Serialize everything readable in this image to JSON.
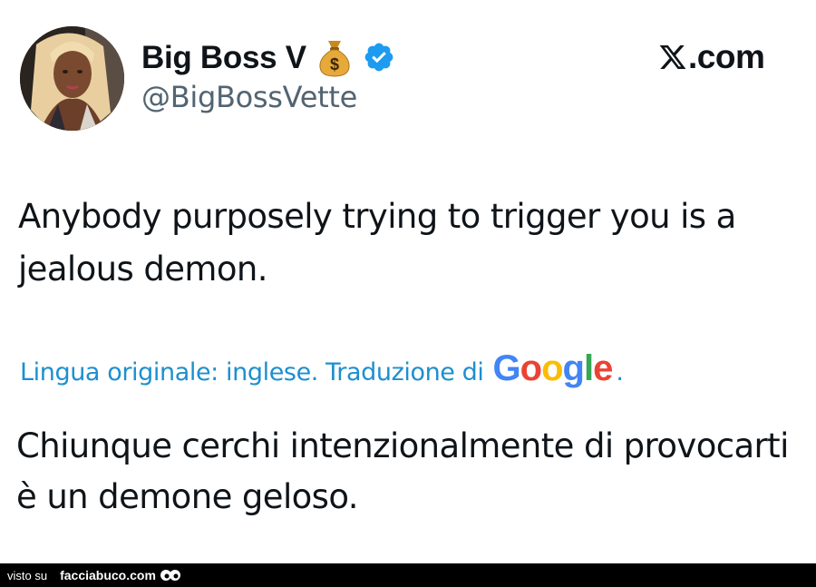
{
  "tweet": {
    "display_name": "Big Boss V",
    "name_emoji": "money-bag-icon",
    "verified_badge": "verified-badge-icon",
    "handle": "@BigBossVette",
    "source_logo": "X",
    "source_domain": ".com",
    "text": "Anybody purposely trying to trigger you is a jealous demon.",
    "translation_note": "Lingua originale: inglese. Traduzione di",
    "translation_provider": [
      "G",
      "o",
      "o",
      "g",
      "l",
      "e"
    ],
    "translation_period": ".",
    "translated_text": "Chiunque cerchi intenzionalmente di provocarti è un demone geloso."
  },
  "footer": {
    "label": "visto su",
    "site": "facciabuco.com",
    "mascot_icon": "eyes-icon"
  },
  "colors": {
    "link_blue": "#1d8fcf",
    "verified_blue": "#1d9bf0",
    "footer_bg": "#000000"
  }
}
